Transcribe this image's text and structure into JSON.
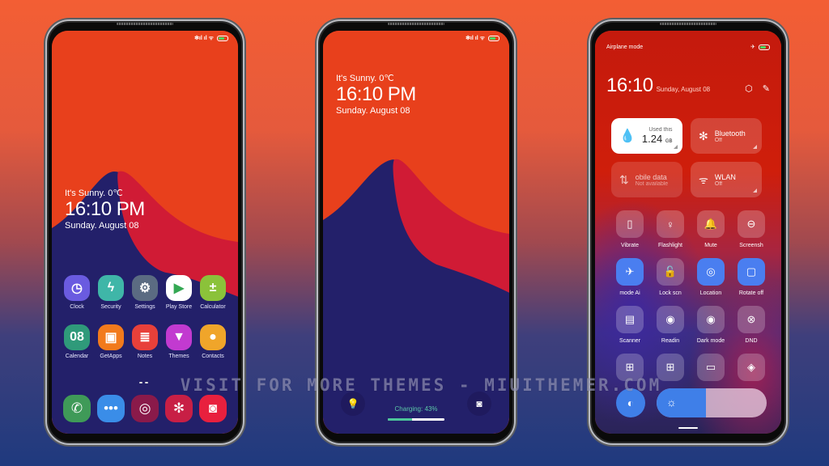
{
  "colors": {
    "wallpaper_orange": "#e8401c",
    "wallpaper_red": "#d01b35",
    "wallpaper_navy": "#23206a",
    "accent_blue": "#4a7ef0",
    "charging_green": "#4cc59a"
  },
  "status_bar": {
    "icons": [
      "bluetooth-icon",
      "signal-icon",
      "signal-icon",
      "wifi-icon",
      "battery-icon"
    ],
    "text": "✻ıl ıl ᯤ"
  },
  "home_screen": {
    "weather": "It's Sunny. 0℃",
    "time": "16:10 PM",
    "date": "Sunday. August 08",
    "apps": [
      {
        "label": "Clock",
        "icon": "clock-icon",
        "glyph": "◷",
        "color": "#6a5be0"
      },
      {
        "label": "Security",
        "icon": "security-icon",
        "glyph": "ϟ",
        "color": "#3fb6a8"
      },
      {
        "label": "Settings",
        "icon": "settings-icon",
        "glyph": "⚙",
        "color": "#5b6b82"
      },
      {
        "label": "Play Store",
        "icon": "play-store-icon",
        "glyph": "▶",
        "color": "#ffffff"
      },
      {
        "label": "Calculator",
        "icon": "calculator-icon",
        "glyph": "±",
        "color": "#8bc23a"
      },
      {
        "label": "Calendar",
        "icon": "calendar-icon",
        "glyph": "08",
        "color": "#2f9a7a"
      },
      {
        "label": "GetApps",
        "icon": "getapps-icon",
        "glyph": "▣",
        "color": "#f27a1c"
      },
      {
        "label": "Notes",
        "icon": "notes-icon",
        "glyph": "≣",
        "color": "#e8403a"
      },
      {
        "label": "Themes",
        "icon": "themes-icon",
        "glyph": "▼",
        "color": "#c23ad0"
      },
      {
        "label": "Contacts",
        "icon": "contacts-icon",
        "glyph": "●",
        "color": "#f0a52a"
      }
    ],
    "dock": [
      {
        "icon": "phone-icon",
        "glyph": "✆",
        "color": "#3f9a58"
      },
      {
        "icon": "messages-icon",
        "glyph": "•••",
        "color": "#3a8de8"
      },
      {
        "icon": "fingerprint-icon",
        "glyph": "◎",
        "color": "#8a1a4a"
      },
      {
        "icon": "gallery-icon",
        "glyph": "✻",
        "color": "#c81f45"
      },
      {
        "icon": "camera-icon",
        "glyph": "◙",
        "color": "#e8203e"
      }
    ]
  },
  "lock_screen": {
    "weather": "It's Sunny. 0℃",
    "time": "16:10 PM",
    "date": "Sunday. August 08",
    "charging_label": "Charging: 43%",
    "charging_percent": 43,
    "flashlight_glyph": "💡",
    "camera_glyph": "◙"
  },
  "control_center": {
    "airplane_label": "Airplane mode",
    "time": "16:10",
    "date": "Sunday, August 08",
    "data_tile": {
      "caption": "Used this",
      "value": "1.24",
      "unit": "GB"
    },
    "bluetooth_tile": {
      "label": "Bluetooth",
      "state": "Off"
    },
    "mobile_tile": {
      "label": "obile data",
      "state": "Not available"
    },
    "wlan_tile": {
      "label": "WLAN",
      "state": "Off"
    },
    "toggles": [
      {
        "label": "Vibrate",
        "icon": "vibrate-icon",
        "glyph": "▯",
        "on": false
      },
      {
        "label": "Flashlight",
        "icon": "flashlight-icon",
        "glyph": "♀",
        "on": false
      },
      {
        "label": "Mute",
        "icon": "bell-icon",
        "glyph": "🔔",
        "on": false
      },
      {
        "label": "Screensh",
        "icon": "screenshot-icon",
        "glyph": "⊖",
        "on": false
      },
      {
        "label": "mode    Ai",
        "icon": "airplane-icon",
        "glyph": "✈",
        "on": true
      },
      {
        "label": "Lock scn",
        "icon": "lock-icon",
        "glyph": "🔓",
        "on": false
      },
      {
        "label": "Location",
        "icon": "location-icon",
        "glyph": "◎",
        "on": true
      },
      {
        "label": "Rotate off",
        "icon": "rotate-icon",
        "glyph": "▢",
        "on": true
      },
      {
        "label": "Scanner",
        "icon": "scanner-icon",
        "glyph": "▤",
        "on": false
      },
      {
        "label": "Readin",
        "icon": "reading-icon",
        "glyph": "◉",
        "on": false
      },
      {
        "label": "Dark mode",
        "icon": "dark-mode-icon",
        "glyph": "◉",
        "on": false
      },
      {
        "label": "DND",
        "icon": "dnd-icon",
        "glyph": "⊗",
        "on": false
      },
      {
        "label": "",
        "icon": "battery-saver-icon",
        "glyph": "⊞",
        "on": false
      },
      {
        "label": "",
        "icon": "ultra-battery-icon",
        "glyph": "⊞",
        "on": false
      },
      {
        "label": "",
        "icon": "cast-icon",
        "glyph": "▭",
        "on": false
      },
      {
        "label": "",
        "icon": "mi-share-icon",
        "glyph": "◈",
        "on": false
      }
    ],
    "brightness_percent": 45,
    "auto_brightness_glyph": "◐",
    "sun_glyph": "☼"
  },
  "watermark": "VISIT FOR MORE THEMES - MIUITHEMER.COM"
}
